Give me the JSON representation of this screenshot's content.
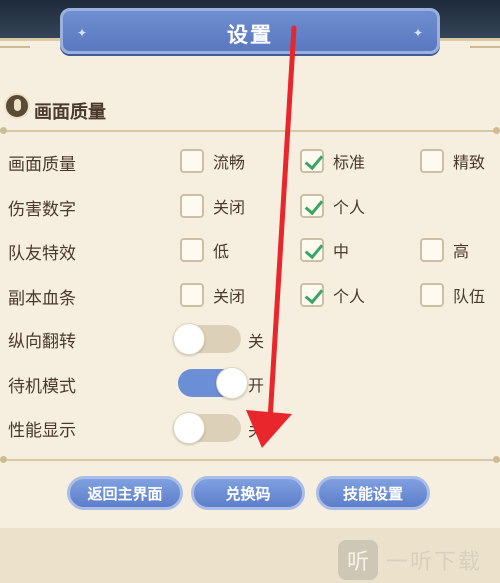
{
  "header": {
    "title": "设置"
  },
  "section": {
    "title": "画面质量"
  },
  "rows": [
    {
      "label": "画面质量",
      "options": [
        {
          "label": "流畅",
          "checked": false
        },
        {
          "label": "标准",
          "checked": true
        },
        {
          "label": "精致",
          "checked": false
        }
      ]
    },
    {
      "label": "伤害数字",
      "options": [
        {
          "label": "关闭",
          "checked": false
        },
        {
          "label": "个人",
          "checked": true
        }
      ]
    },
    {
      "label": "队友特效",
      "options": [
        {
          "label": "低",
          "checked": false
        },
        {
          "label": "中",
          "checked": true
        },
        {
          "label": "高",
          "checked": false
        }
      ]
    },
    {
      "label": "副本血条",
      "options": [
        {
          "label": "关闭",
          "checked": false
        },
        {
          "label": "个人",
          "checked": true
        },
        {
          "label": "队伍",
          "checked": false
        }
      ]
    }
  ],
  "toggles": [
    {
      "label": "纵向翻转",
      "state": "关",
      "on": false
    },
    {
      "label": "待机模式",
      "state": "开",
      "on": true
    },
    {
      "label": "性能显示",
      "state": "关",
      "on": false
    }
  ],
  "buttons": {
    "main_menu": "返回主界面",
    "redeem": "兑换码",
    "skill_settings": "技能设置"
  },
  "watermark": {
    "logo": "听",
    "text": "一听下载"
  },
  "colors": {
    "accent_blue": "#5d7ec9",
    "check_green": "#3aa564",
    "arrow_red": "#e8262b",
    "panel_bg": "#f6efdf"
  }
}
